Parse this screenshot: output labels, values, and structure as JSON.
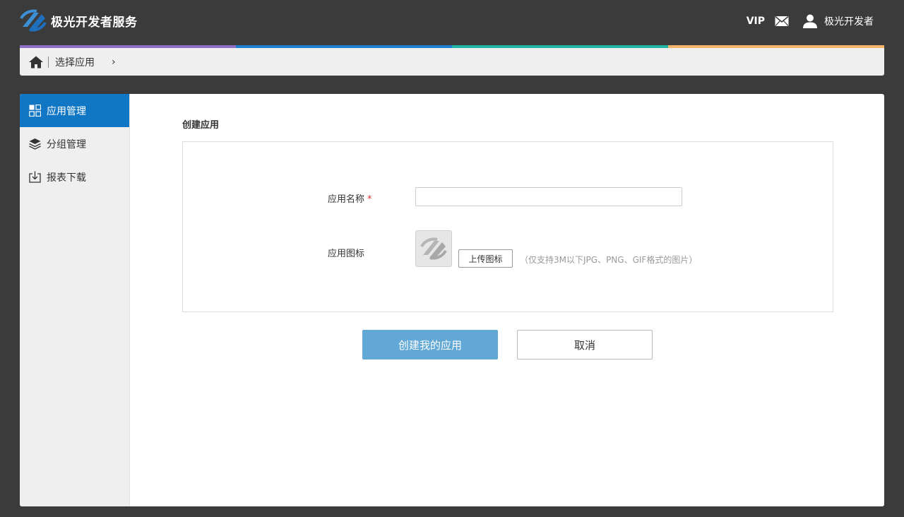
{
  "header": {
    "brand_name": "极光开发者服务",
    "vip_label": "VIP",
    "username": "极光开发者"
  },
  "colors": {
    "stripe": [
      "#8e6fc4",
      "#1f7fcf",
      "#1fb3a3",
      "#f2b56a"
    ],
    "accent": "#1177c5",
    "primary_button": "#62a8d6"
  },
  "breadcrumb": {
    "current": "选择应用",
    "chevron": "›"
  },
  "sidebar": {
    "items": [
      {
        "label": "应用管理",
        "icon": "grid-icon",
        "active": true
      },
      {
        "label": "分组管理",
        "icon": "layers-icon",
        "active": false
      },
      {
        "label": "报表下载",
        "icon": "download-icon",
        "active": false
      }
    ]
  },
  "form": {
    "title": "创建应用",
    "app_name_label": "应用名称",
    "required_mark": "*",
    "app_name_value": "",
    "app_icon_label": "应用图标",
    "upload_button": "上传图标",
    "upload_hint": "（仅支持3M以下JPG、PNG、GIF格式的图片）"
  },
  "actions": {
    "create_label": "创建我的应用",
    "cancel_label": "取消"
  }
}
